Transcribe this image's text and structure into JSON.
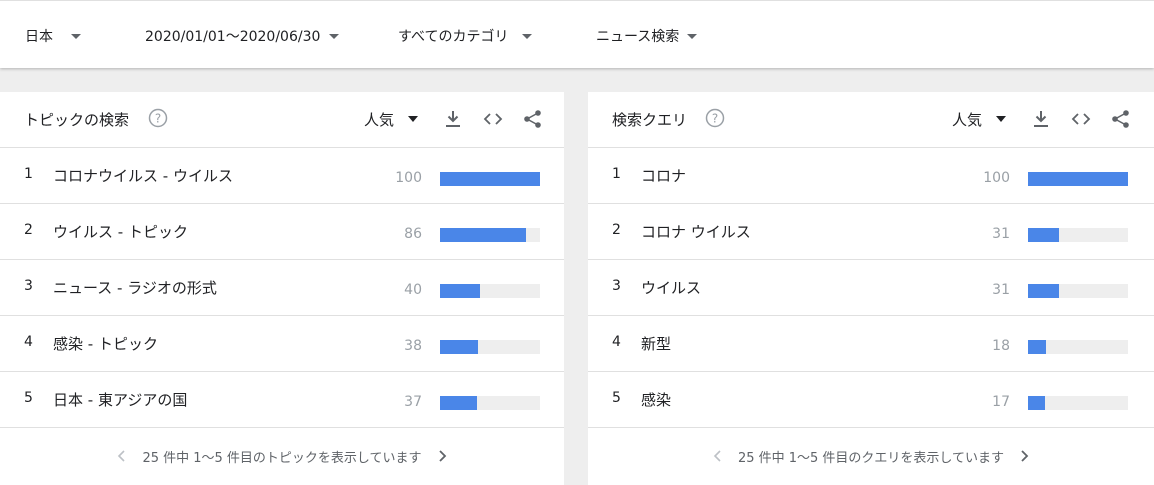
{
  "filters": {
    "region": "日本",
    "date_range": "2020/01/01〜2020/06/30",
    "category": "すべてのカテゴリ",
    "search_type": "ニュース検索"
  },
  "topics_panel": {
    "title": "トピックの検索",
    "sort": "人気",
    "rows": [
      {
        "rank": "1",
        "label": "コロナウイルス - ウイルス",
        "score": 100
      },
      {
        "rank": "2",
        "label": "ウイルス - トピック",
        "score": 86
      },
      {
        "rank": "3",
        "label": "ニュース - ラジオの形式",
        "score": 40
      },
      {
        "rank": "4",
        "label": "感染 - トピック",
        "score": 38
      },
      {
        "rank": "5",
        "label": "日本 - 東アジアの国",
        "score": 37
      }
    ],
    "pager_text": "25 件中 1〜5 件目のトピックを表示しています"
  },
  "queries_panel": {
    "title": "検索クエリ",
    "sort": "人気",
    "rows": [
      {
        "rank": "1",
        "label": "コロナ",
        "score": 100
      },
      {
        "rank": "2",
        "label": "コロナ ウイルス",
        "score": 31
      },
      {
        "rank": "3",
        "label": "ウイルス",
        "score": 31
      },
      {
        "rank": "4",
        "label": "新型",
        "score": 18
      },
      {
        "rank": "5",
        "label": "感染",
        "score": 17
      }
    ],
    "pager_text": "25 件中 1〜5 件目のクエリを表示しています"
  },
  "colors": {
    "bar_fill": "#4a86e8",
    "bar_track": "#eeeeee",
    "icon": "#5f6368"
  },
  "icons": {
    "help": "help-circle-icon",
    "download": "download-icon",
    "embed": "code-icon",
    "share": "share-icon",
    "prev": "chevron-left-icon",
    "next": "chevron-right-icon"
  }
}
